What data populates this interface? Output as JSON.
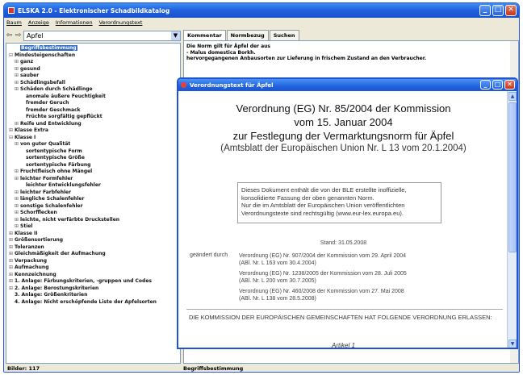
{
  "window": {
    "title": "ELSKA 2.0 - Elektronischer Schadbildkatalog",
    "buttons": [
      "_",
      "□",
      "✕"
    ]
  },
  "menu": [
    "Baum",
    "Anzeige",
    "Informationen",
    "Verordnungstext"
  ],
  "selector": {
    "value": "Apfel"
  },
  "tree": [
    {
      "label": "Begriffsbestimmung",
      "level": 1,
      "selected": true
    },
    {
      "label": "Mindesteigenschaften",
      "level": 0,
      "exp": "⊟"
    },
    {
      "label": "ganz",
      "level": 1,
      "exp": "⊞"
    },
    {
      "label": "gesund",
      "level": 1,
      "exp": "⊞"
    },
    {
      "label": "sauber",
      "level": 1,
      "exp": "⊞"
    },
    {
      "label": "Schädlingsbefall",
      "level": 1,
      "exp": "⊞"
    },
    {
      "label": "Schäden durch Schädlinge",
      "level": 1,
      "exp": "⊞"
    },
    {
      "label": "anomale äußere Feuchtigkeit",
      "level": 2
    },
    {
      "label": "fremder Geruch",
      "level": 2
    },
    {
      "label": "fremder Geschmack",
      "level": 2
    },
    {
      "label": "Früchte sorgfältig gepflückt",
      "level": 2
    },
    {
      "label": "Reife und Entwicklung",
      "level": 1,
      "exp": "⊞"
    },
    {
      "label": "Klasse Extra",
      "level": 0,
      "exp": "⊞"
    },
    {
      "label": "Klasse I",
      "level": 0,
      "exp": "⊟"
    },
    {
      "label": "von guter Qualität",
      "level": 1,
      "exp": "⊞"
    },
    {
      "label": "sortentypische Form",
      "level": 2
    },
    {
      "label": "sortentypische Größe",
      "level": 2
    },
    {
      "label": "sortentypische Färbung",
      "level": 2
    },
    {
      "label": "Fruchtfleisch ohne Mängel",
      "level": 1,
      "exp": "⊞"
    },
    {
      "label": "leichter Formfehler",
      "level": 1,
      "exp": "⊞"
    },
    {
      "label": "leichter Entwicklungsfehler",
      "level": 2
    },
    {
      "label": "leichter Farbfehler",
      "level": 1,
      "exp": "⊞"
    },
    {
      "label": "längliche Schalenfehler",
      "level": 1,
      "exp": "⊞"
    },
    {
      "label": "sonstige Schalenfehler",
      "level": 1,
      "exp": "⊞"
    },
    {
      "label": "Schorfflecken",
      "level": 1,
      "exp": "⊞"
    },
    {
      "label": "leichte, nicht verfärbte Druckstellen",
      "level": 1,
      "exp": "⊞"
    },
    {
      "label": "Stiel",
      "level": 1,
      "exp": "⊞"
    },
    {
      "label": "Klasse II",
      "level": 0,
      "exp": "⊞"
    },
    {
      "label": "Größensortierung",
      "level": 0,
      "exp": "⊞"
    },
    {
      "label": "Toleranzen",
      "level": 0,
      "exp": "⊞"
    },
    {
      "label": "Gleichmäßigkeit der Aufmachung",
      "level": 0,
      "exp": "⊞"
    },
    {
      "label": "Verpackung",
      "level": 0,
      "exp": "⊞"
    },
    {
      "label": "Aufmachung",
      "level": 0,
      "exp": "⊞"
    },
    {
      "label": "Kennzeichnung",
      "level": 0,
      "exp": "⊞"
    },
    {
      "label": "1. Anlage: Färbungskriterien, -gruppen und Codes",
      "level": 0,
      "exp": "⊞"
    },
    {
      "label": "2. Anlage: Berostungskriterien",
      "level": 0,
      "exp": "⊞"
    },
    {
      "label": "3. Anlage: Größenkriterien",
      "level": 0,
      "exp": ""
    },
    {
      "label": "4. Anlage: Nicht erschöpfende Liste der Apfelsorten",
      "level": 0,
      "exp": ""
    }
  ],
  "tabs": [
    "Kommentar",
    "Normbezug",
    "Suchen"
  ],
  "comment": [
    "Die Norm gilt für Äpfel der aus",
    "- Malus domestica Borkh.",
    "hervorgegangenen Anbausorten zur Lieferung in frischem Zustand an den Verbraucher."
  ],
  "status": {
    "left": "Bilder: 117",
    "right": "Begriffsbestimmung"
  },
  "popup": {
    "title": "Verordnungstext für Äpfel",
    "heading1": "Verordnung (EG) Nr. 85/2004 der Kommission",
    "heading2": "vom 15. Januar 2004",
    "heading3": "zur Festlegung der Vermarktungsnorm für Äpfel",
    "heading4": "(Amtsblatt der Europäischen Union Nr. L 13 vom 20.1.2004)",
    "box": [
      "Dieses Dokument enthält die von der BLE erstellte inoffizielle,",
      "konsolidierte Fassung der oben genannten Norm.",
      "Nur die im Amtsblatt der Europäischen Union veröffentlichten",
      "Verordnungstexte sind rechtsgültig (www.eur-lex.europa.eu)."
    ],
    "stand": "Stand: 31.05.2008",
    "amend_label": "geändert durch",
    "amendments": [
      [
        "Verordnung (EG) Nr. 907/2004 der Kommission vom 29. April 2004",
        "(ABl. Nr. L 163 vom 30.4.2004)"
      ],
      [
        "Verordnung (EG) Nr. 1238/2005 der Kommission vom 28. Juli 2005",
        "(ABl. Nr. L 200 vom 30.7.2005)"
      ],
      [
        "Verordnung (EG) Nr. 460/2008 der Kommission vom 27. Mai 2008",
        "(ABl. Nr. L 138 vom 28.5.2008)"
      ]
    ],
    "kommission": "DIE KOMMISSION DER EUROPÄISCHEN GEMEINSCHAFTEN HAT FOLGENDE VERORDNUNG ERLASSEN:",
    "artikel": "Artikel 1"
  }
}
